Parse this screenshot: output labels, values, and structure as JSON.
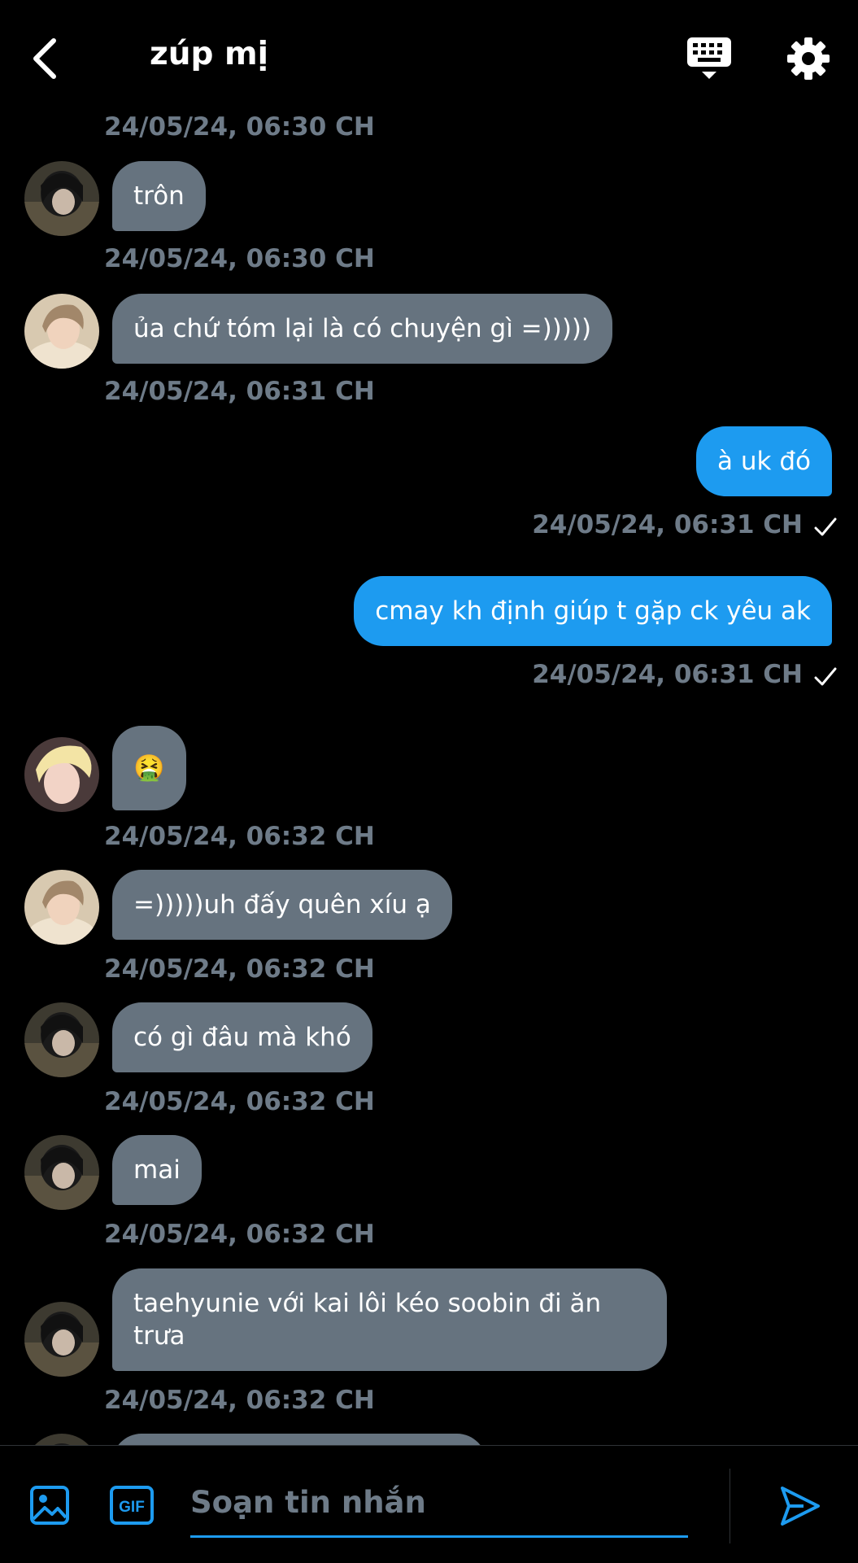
{
  "header": {
    "title": "zúp mị"
  },
  "messages": [
    {
      "ts_above": "24/05/24, 06:30 CH",
      "text": "trôn",
      "avatar": "avatar-1"
    },
    {
      "ts_above": "24/05/24, 06:30 CH",
      "text": "ủa chứ tóm lại là có chuyện gì =)))))",
      "avatar": "avatar-2"
    },
    {
      "ts_above": "24/05/24, 06:31 CH"
    },
    {
      "text": "à uk đó",
      "ts_below": "24/05/24, 06:31 CH"
    },
    {
      "text": "cmay kh định giúp t gặp ck yêu ak",
      "ts_below": "24/05/24, 06:31 CH"
    },
    {
      "text": "🤮",
      "avatar": "avatar-3",
      "ts_below": "24/05/24, 06:32 CH"
    },
    {
      "text": "=)))))uh đấy quên xíu ạ",
      "avatar": "avatar-2",
      "ts_below": "24/05/24, 06:32 CH"
    },
    {
      "text": "có gì đâu mà khó",
      "avatar": "avatar-1",
      "ts_below": "24/05/24, 06:32 CH"
    },
    {
      "text": "mai",
      "avatar": "avatar-1",
      "ts_below": "24/05/24, 06:32 CH"
    },
    {
      "text": "taehyunie với kai lôi kéo soobin đi ăn trưa",
      "avatar": "avatar-1",
      "ts_below": "24/05/24, 06:32 CH"
    }
  ],
  "composer": {
    "placeholder": "Soạn tin nhắn"
  },
  "colors": {
    "incoming_bubble": "#66737f",
    "outgoing_bubble": "#1d9bf0",
    "timestamp": "#6e7b88",
    "background": "#000000"
  },
  "icons": [
    "back-arrow-icon",
    "keyboard-icon",
    "gear-icon",
    "image-icon",
    "gif-icon",
    "send-icon",
    "checkmark-icon"
  ]
}
